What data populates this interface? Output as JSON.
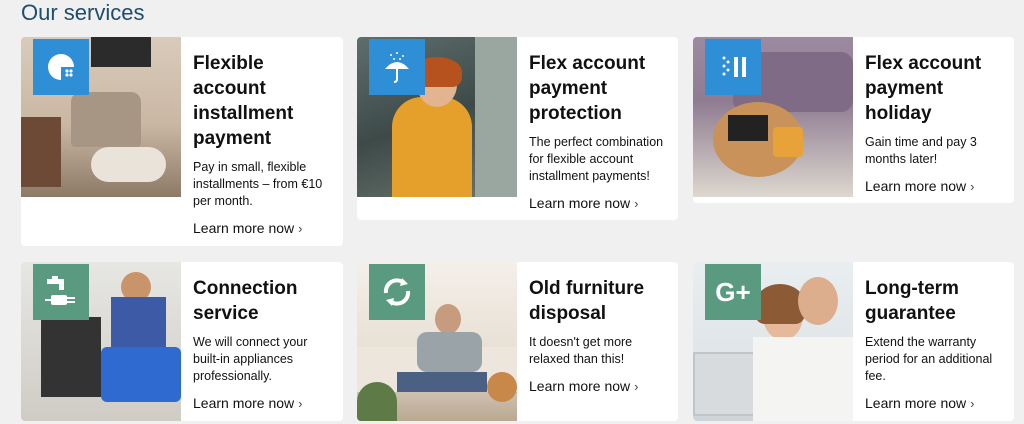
{
  "section": {
    "heading": "Our services"
  },
  "colors": {
    "heading": "#1f4d6b",
    "badge_blue": "#2f8fd6",
    "badge_green": "#5a9a80"
  },
  "cards": [
    {
      "title": "Flexible account installment payment",
      "description": "Pay in small, flexible installments – from €10 per month.",
      "link": "Learn more now",
      "chevron": "›",
      "icon": "pie-chart-icon",
      "image": "living-room-armchair-photo"
    },
    {
      "title": "Flex account payment protection",
      "description": "The perfect combination for flexible account installment payments!",
      "link": "Learn more now",
      "chevron": "›",
      "icon": "umbrella-icon",
      "image": "couple-in-rain-photo"
    },
    {
      "title": "Flex account payment holiday",
      "description": "Gain time and pay 3 months later!",
      "link": "Learn more now",
      "chevron": "›",
      "icon": "pause-icon",
      "image": "sofa-tic-tac-toe-photo"
    },
    {
      "title": "Connection service",
      "description": "We will connect your built-in appliances professionally.",
      "link": "Learn more now",
      "chevron": "›",
      "icon": "faucet-plug-icon",
      "image": "technician-oven-photo"
    },
    {
      "title": "Old furniture disposal",
      "description": "It doesn't get more relaxed than this!",
      "link": "Learn more now",
      "chevron": "›",
      "icon": "recycle-arrows-icon",
      "image": "relaxed-man-headphones-photo"
    },
    {
      "title": "Long-term guarantee",
      "description": "Extend the warranty period for an additional fee.",
      "link": "Learn more now",
      "chevron": "›",
      "icon": "g-plus-icon",
      "badge_text": "G+",
      "image": "happy-couple-laptop-photo"
    }
  ]
}
